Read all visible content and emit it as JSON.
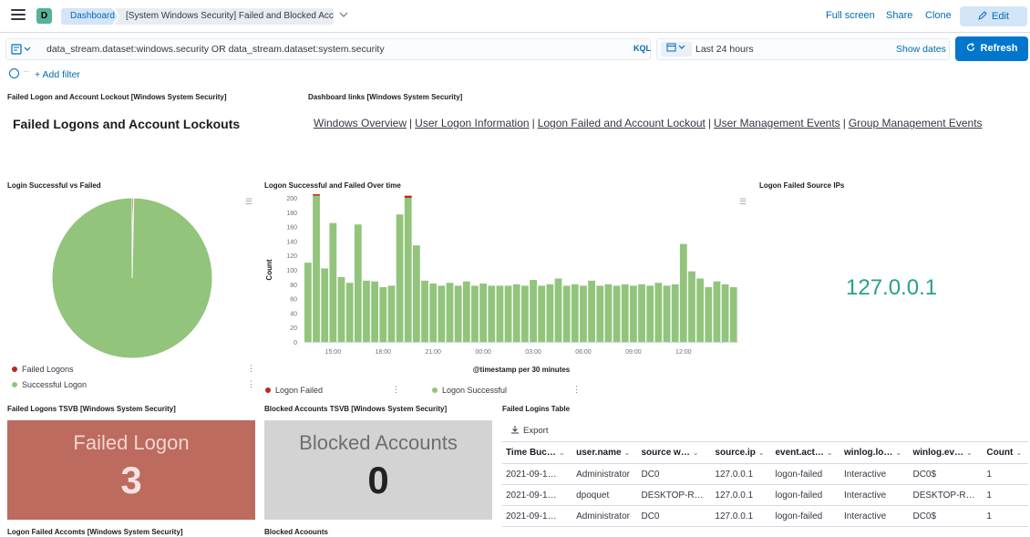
{
  "header": {
    "space_initial": "D",
    "breadcrumb_root": "Dashboard",
    "breadcrumb_current": "[System Windows Security] Failed and Blocked Accounts",
    "actions": [
      "Full screen",
      "Share",
      "Clone"
    ],
    "edit_label": "Edit"
  },
  "query": {
    "text": "data_stream.dataset:windows.security OR data_stream.dataset:system.security",
    "language": "KQL",
    "time_range": "Last 24 hours",
    "show_dates": "Show dates",
    "refresh_label": "Refresh",
    "add_filter": "+ Add filter"
  },
  "panels": {
    "markdown_title": "Failed Logon and Account Lockout [Windows System Security]",
    "markdown_heading": "Failed Logons and Account Lockouts",
    "links_title": "Dashboard links [Windows System Security]",
    "links": [
      "Windows Overview",
      "User Logon Information",
      "Logon Failed and Account Lockout",
      "User Management Events",
      "Group Management Events"
    ],
    "pie_title": "Login Successful vs Failed",
    "pie_legend": [
      {
        "label": "Failed Logons",
        "color": "#bd271e"
      },
      {
        "label": "Successful Logon",
        "color": "#92c47c"
      }
    ],
    "hist_title": "Logon Successful and Failed Over time",
    "hist_legend": [
      {
        "label": "Logon Failed",
        "color": "#bd271e"
      },
      {
        "label": "Logon Successful",
        "color": "#92c47c"
      }
    ],
    "source_ips_title": "Logon Failed Source IPs",
    "source_ip_value": "127.0.0.1",
    "tsvb_failed_title": "Failed Logons TSVB [Windows System Security]",
    "tsvb_failed_label": "Failed Logon",
    "tsvb_failed_value": "3",
    "tsvb_blocked_title": "Blocked Accounts TSVB [Windows System Security]",
    "tsvb_blocked_label": "Blocked Accounts",
    "tsvb_blocked_value": "0",
    "table_title": "Failed Logins Table",
    "export_label": "Export",
    "bottom_left_title": "Logon Failed Accomts [Windows System Security]",
    "bottom_mid_title": "Blocked Acoounts"
  },
  "table": {
    "columns": [
      "Time Buc…",
      "user.name",
      "source w…",
      "source.ip",
      "event.act…",
      "winlog.lo…",
      "winlog.ev…",
      "Count"
    ],
    "rows": [
      [
        "2021-09-1…",
        "Administrator",
        "DC0",
        "127.0.0.1",
        "logon-failed",
        "Interactive",
        "DC0$",
        "1"
      ],
      [
        "2021-09-1…",
        "dpoquet",
        "DESKTOP-R…",
        "127.0.0.1",
        "logon-failed",
        "Interactive",
        "DESKTOP-R…",
        "1"
      ],
      [
        "2021-09-1…",
        "Administrator",
        "DC0",
        "127.0.0.1",
        "logon-failed",
        "Interactive",
        "DC0$",
        "1"
      ]
    ]
  },
  "chart_data": [
    {
      "type": "pie",
      "title": "Login Successful vs Failed",
      "categories": [
        "Failed Logons",
        "Successful Logon"
      ],
      "values": [
        0.3,
        99.7
      ],
      "colors": [
        "#bd271e",
        "#92c47c"
      ]
    },
    {
      "type": "bar",
      "title": "Logon Successful and Failed Over time",
      "xlabel": "@timestamp per 30 minutes",
      "ylabel": "Count",
      "ylim": [
        0,
        200
      ],
      "yticks": [
        0,
        20,
        40,
        60,
        80,
        100,
        120,
        140,
        160,
        180,
        200
      ],
      "xticks": [
        "15:00",
        "18:00",
        "21:00",
        "00:00",
        "03:00",
        "06:00",
        "09:00",
        "12:00"
      ],
      "series": [
        {
          "name": "Logon Successful",
          "color": "#92c47c",
          "values": [
            110,
            203,
            102,
            165,
            90,
            82,
            163,
            85,
            84,
            76,
            78,
            177,
            200,
            134,
            85,
            81,
            78,
            82,
            78,
            84,
            78,
            81,
            78,
            78,
            78,
            80,
            78,
            86,
            78,
            80,
            88,
            78,
            80,
            78,
            85,
            78,
            80,
            78,
            80,
            78,
            80,
            78,
            82,
            78,
            80,
            136,
            98,
            88,
            76,
            84,
            80,
            76
          ]
        },
        {
          "name": "Logon Failed",
          "color": "#bd271e",
          "values": [
            0,
            2,
            0,
            0,
            0,
            0,
            0,
            0,
            0,
            0,
            0,
            0,
            3,
            0,
            0,
            0,
            0,
            0,
            0,
            0,
            0,
            0,
            0,
            0,
            0,
            0,
            0,
            0,
            0,
            0,
            0,
            0,
            0,
            0,
            0,
            0,
            0,
            0,
            0,
            0,
            0,
            0,
            0,
            0,
            0,
            0,
            0,
            0,
            0,
            0,
            0,
            0
          ]
        }
      ]
    }
  ]
}
